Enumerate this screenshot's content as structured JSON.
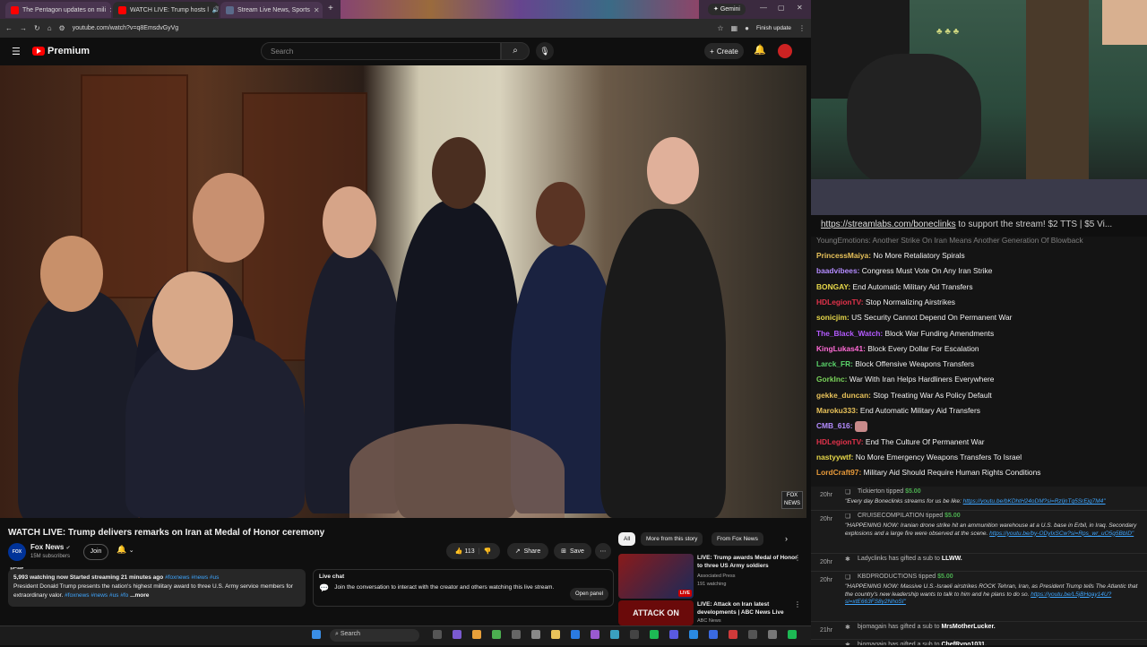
{
  "browser": {
    "tabs": [
      {
        "label": "The Pentagon updates on mili",
        "fav": "#ff0000"
      },
      {
        "label": "WATCH LIVE: Trump hosts l",
        "fav": "#ff0000"
      },
      {
        "label": "Stream Live News, Sports",
        "fav": "#5a6a8a"
      }
    ],
    "gemini": "Gemini",
    "url": "youtube.com/watch?v=q8EmsdvGyVg",
    "finish_update": "Finish update"
  },
  "yt": {
    "logo": "Premium",
    "search_placeholder": "Search",
    "create": "Create"
  },
  "video": {
    "overlay_logo": "FOX NEWS",
    "title": "WATCH LIVE: Trump delivers remarks on Iran at Medal of Honor ceremony",
    "channel": "Fox News",
    "subscribers": "15M subscribers",
    "avatar_text": "FOX NEWS",
    "join": "Join",
    "likes": "113",
    "share": "Share",
    "save": "Save",
    "desc_stats": "5,993 watching now  Started streaming 21 minutes ago",
    "desc_tags_top": "#foxnews #news #us",
    "desc_text": "President Donald Trump presents the nation's highest military award to three U.S. Army service members for extraordinary valor.",
    "desc_tags_bottom": "#foxnews #news #us #fo",
    "desc_more": "...more"
  },
  "live_chat": {
    "title": "Live chat",
    "text": "Join the conversation to interact with the creator and others watching this live stream.",
    "open_panel": "Open panel"
  },
  "chips": [
    "All",
    "More from this story",
    "From Fox News"
  ],
  "recs": [
    {
      "title": "LIVE: Trump awards Medal of Honor to three US Army soldiers",
      "channel": "Associated Press",
      "meta": "191 watching",
      "badge": "LIVE"
    },
    {
      "title": "LIVE: Attack on Iran latest developments | ABC News Live",
      "channel": "ABC News",
      "thumb_text": "ATTACK ON"
    }
  ],
  "taskbar": {
    "search": "Search"
  },
  "stream": {
    "banner_link": "https://streamlabs.com/boneclinks",
    "banner_rest": " to support the stream! $2 TTS | $5 Vi...",
    "top_partial": "YoungEmotions: Another Strike On Iran Means Another Generation Of Blowback",
    "messages": [
      {
        "user": "PrincessMaiya:",
        "text": "No More Retaliatory Spirals",
        "color": "#e8c25a"
      },
      {
        "user": "baadvibees:",
        "text": "Congress Must Vote On Any Iran Strike",
        "color": "#b48cff"
      },
      {
        "user": "BONGAY:",
        "text": "End Automatic Military Aid Transfers",
        "color": "#e8d84a"
      },
      {
        "user": "HDLegionTV:",
        "text": "Stop Normalizing Airstrikes",
        "color": "#e0324a"
      },
      {
        "user": "sonicjim:",
        "text": "US Security Cannot Depend On Permanent War",
        "color": "#e8d84a"
      },
      {
        "user": "The_Black_Watch:",
        "text": "Block War Funding Amendments",
        "color": "#b45aff"
      },
      {
        "user": "KingLukas41:",
        "text": "Block Every Dollar For Escalation",
        "color": "#ff6ad5"
      },
      {
        "user": "Larck_FR:",
        "text": "Block Offensive Weapons Transfers",
        "color": "#5ad36a"
      },
      {
        "user": "GorkInc:",
        "text": "War With Iran Helps Hardliners Everywhere",
        "color": "#7ad35a"
      },
      {
        "user": "gekke_duncan:",
        "text": "Stop Treating War As Policy Default",
        "color": "#e8c25a"
      },
      {
        "user": "Maroku333:",
        "text": "End Automatic Military Aid Transfers",
        "color": "#e8c25a"
      },
      {
        "user": "CMB_616:",
        "text": "",
        "color": "#b48cff"
      },
      {
        "user": "HDLegionTV:",
        "text": "End The Culture Of Permanent War",
        "color": "#e0324a"
      },
      {
        "user": "nastyywtf:",
        "text": "No More Emergency Weapons Transfers To Israel",
        "color": "#e8d84a"
      },
      {
        "user": "LordCraft97:",
        "text": "Military Aid Should Require Human Rights Conditions",
        "color": "#e89a3a"
      }
    ],
    "tips": [
      {
        "time": "20hr",
        "user": "Tickierton",
        "action": "tipped",
        "amount": "$5.00",
        "body": "\"Every day Boneclinks streams for us be like: ",
        "link": "https://youtu.be/bKDhtH24oDM?si=RzIjnTq5SrEjq7M4\""
      },
      {
        "time": "20hr",
        "user": "CRUISECOMPILATION",
        "action": "tipped",
        "amount": "$5.00",
        "body": "\"HAPPENING NOW: Iranian drone strike hit an ammunition warehouse at a U.S. base in Erbil, in Iraq. Secondary explosions and a large fire were observed at the scene. ",
        "link": "https://youtu.be/by-ODyIxSCw?si=Rps_wr_uO5g5BbID\""
      },
      {
        "time": "20hr",
        "user": "Ladyclinks",
        "action": "has gifted a sub to",
        "amount": "LLWW."
      },
      {
        "time": "20hr",
        "user": "KBDPRODUCTIONS",
        "action": "tipped",
        "amount": "$5.00",
        "body": "\"HAPPENING NOW: Massive U.S.-Israeli airstrikes ROCK Tehran, Iran, as President Trump tells The Atlantic that the country's new leadership wants to talk to him and he plans to do so. ",
        "link": "https://youtu.be/L5jBHqay14U?si=xtE663FS8y2NhoSI\""
      },
      {
        "time": "21hr",
        "user": "bjomagain",
        "action": "has gifted a sub to",
        "amount": "MrsMotherLucker."
      },
      {
        "time": "21hr",
        "user": "bjomagain",
        "action": "has gifted a sub to",
        "amount": "ChefRyno1031."
      }
    ]
  }
}
